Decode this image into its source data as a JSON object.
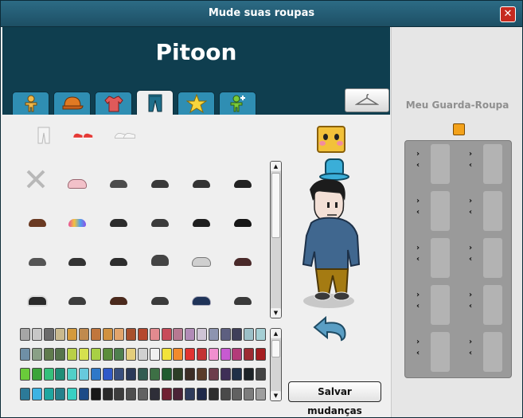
{
  "window": {
    "title": "Mude suas roupas"
  },
  "user": {
    "name": "Pitoon"
  },
  "tabs": [
    {
      "name": "body-tab",
      "icon": "body-icon",
      "active": false
    },
    {
      "name": "hat-tab",
      "icon": "hat-icon",
      "active": false
    },
    {
      "name": "shirt-tab",
      "icon": "shirt-icon",
      "active": false
    },
    {
      "name": "pants-tab",
      "icon": "pants-icon",
      "active": true
    },
    {
      "name": "favorites-tab",
      "icon": "star-icon",
      "active": false
    },
    {
      "name": "effects-tab",
      "icon": "effects-icon",
      "active": false
    }
  ],
  "wardrobe": {
    "title": "Meu Guarda-Roupa",
    "slot_count": 10
  },
  "actions": {
    "save_label": "Salvar mudanças"
  },
  "colors": {
    "titlebar": "#1d4f64",
    "header": "#0f3e4f",
    "tab": "#2f8eb3",
    "close": "#c62a1f"
  },
  "icons": {
    "close": "close-icon",
    "wardrobe": "hanger-icon",
    "rotate": "rotate-arrow-icon",
    "category_pants": "pants-icon",
    "category_shoes": "shoes-icon",
    "category_belt": "belt-icon",
    "remove": "remove-x-icon"
  },
  "palette": {
    "rows": [
      [
        "#a6a6a6",
        "#c7c7c7",
        "#6b6b6b",
        "#c9b98e",
        "#d49a3d",
        "#c08a4d",
        "#c0763d",
        "#d0913f",
        "#e2a46b",
        "#a8502d",
        "#b5482e",
        "#e38a8f",
        "#c84a59",
        "#b77891",
        "#b18bb7",
        "#cfc4d5",
        "#8d94b0",
        "#5d5f80",
        "#3f3f59",
        "#9cc0c8",
        "#a5cfd4"
      ],
      [
        "#6f8fa6",
        "#8aa086",
        "#607b4d",
        "#56734c",
        "#b9cf47",
        "#d6e14e",
        "#a8d045",
        "#5b8d3b",
        "#4e7f4e",
        "#e4cd7b",
        "#d0d0d0",
        "#f1f1f1",
        "#f2e33b",
        "#f28a2c",
        "#e13330",
        "#c43334",
        "#f08fcf",
        "#c75ad1",
        "#b33b79",
        "#9d2b32",
        "#a51e21"
      ],
      [
        "#6acb3a",
        "#3ba43b",
        "#35c07b",
        "#1f8d76",
        "#52d0c8",
        "#67c9dd",
        "#2f78c8",
        "#3059c8",
        "#384e7d",
        "#2b3a59",
        "#335b52",
        "#3d7045",
        "#1f5b2f",
        "#2d3e27",
        "#3c2d26",
        "#5a3c2a",
        "#6d3d4b",
        "#3f2f57",
        "#1f3148",
        "#1d2327",
        "#444444"
      ],
      [
        "#2c7a98",
        "#3db3e3",
        "#1fa6a0",
        "#26808b",
        "#38d0c3",
        "#1c4b87",
        "#181818",
        "#2a2a2a",
        "#3d3d3d",
        "#4f4f4f",
        "#626262",
        "#2e2e38",
        "#702032",
        "#4b2337",
        "#2e3b5b",
        "#202a4a",
        "#2d2d2d",
        "#4a4a4a",
        "#616161",
        "#7d7d7d",
        "#9e9e9e"
      ]
    ]
  }
}
